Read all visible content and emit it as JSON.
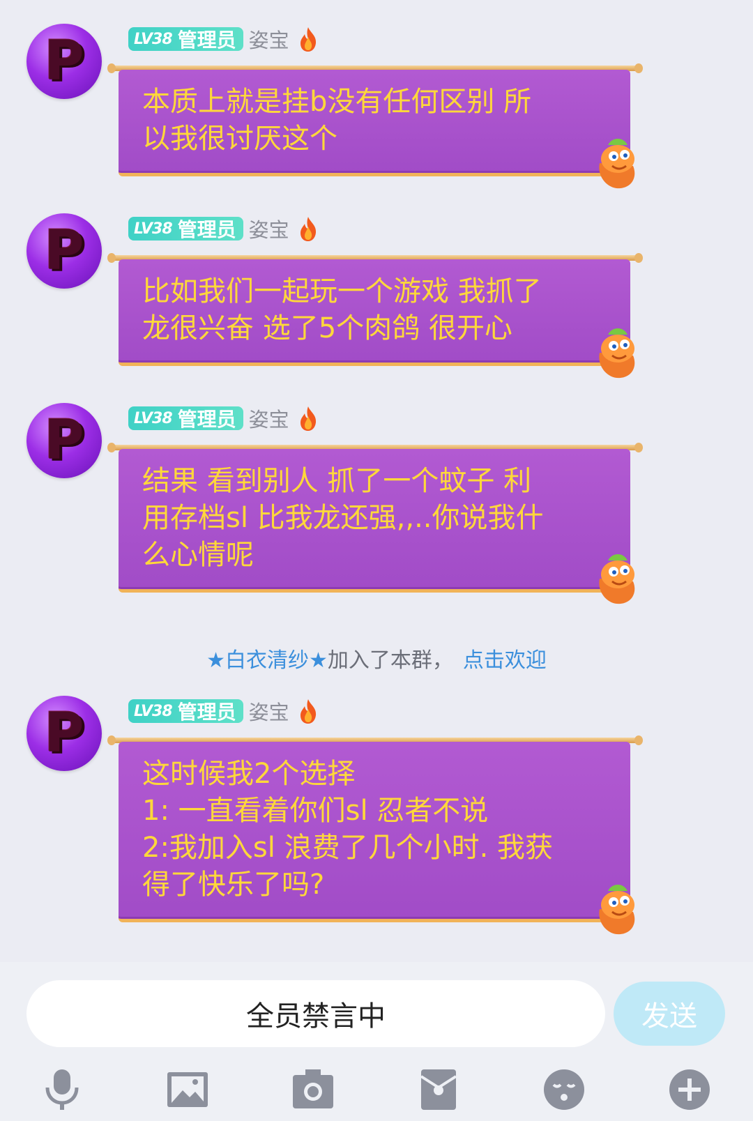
{
  "messages": [
    {
      "level": "LV38",
      "role": "管理员",
      "nickname": "姿宝",
      "text": "本质上就是挂b没有任何区别 所\n以我很讨厌这个"
    },
    {
      "level": "LV38",
      "role": "管理员",
      "nickname": "姿宝",
      "text": "比如我们一起玩一个游戏 我抓了\n龙很兴奋 选了5个肉鸽 很开心"
    },
    {
      "level": "LV38",
      "role": "管理员",
      "nickname": "姿宝",
      "text": "结果 看到别人 抓了一个蚊子 利\n用存档sl 比我龙还强,,..你说我什\n么心情呢"
    },
    {
      "level": "LV38",
      "role": "管理员",
      "nickname": "姿宝",
      "text": "这时候我2个选择\n1: 一直看着你们sl 忍者不说\n2:我加入sl 浪费了几个小时. 我获\n得了快乐了吗?"
    }
  ],
  "system_notice": {
    "name": "★白衣清纱★",
    "text": "加入了本群，",
    "link": "点击欢迎"
  },
  "input": {
    "placeholder": "全员禁言中",
    "send_label": "发送"
  },
  "toolbar": {
    "icons": [
      "microphone-icon",
      "image-icon",
      "camera-icon",
      "red-packet-icon",
      "emoji-icon",
      "plus-icon"
    ]
  },
  "colors": {
    "bubble": "#a84fcb",
    "bubble_text": "#ffd83a",
    "badge": "#4fd9c7",
    "link": "#3b8fdc",
    "send_button": "#bfe9f7"
  }
}
